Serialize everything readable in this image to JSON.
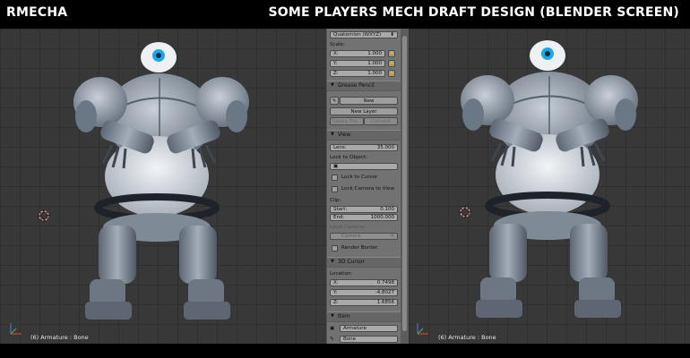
{
  "header": {
    "left_title": "RMECHA",
    "right_title": "SOME PLAYERS MECH DRAFT  DESIGN (BLENDER SCREEN)"
  },
  "viewport_left": {
    "status": "(6) Armature : Bone"
  },
  "viewport_right": {
    "status": "(6) Armature : Bone"
  },
  "panel": {
    "rotation_mode": "Quaternion (WXYZ)",
    "scale": {
      "label": "Scale:",
      "x_label": "X:",
      "x_value": "1.000",
      "y_label": "Y:",
      "y_value": "1.000",
      "z_label": "Z:",
      "z_value": "1.000"
    },
    "grease_pencil": {
      "header": "Grease Pencil",
      "new_button": "New",
      "new_layer_button": "New Layer",
      "delete_frame_button": "Delete Fra...",
      "convert_button": "Convert"
    },
    "view": {
      "header": "View",
      "lens_label": "Lens:",
      "lens_value": "35.000",
      "lock_to_object_label": "Lock to Object:",
      "lock_to_cursor_label": "Lock to Cursor",
      "lock_camera_label": "Lock Camera to View",
      "clip_label": "Clip:",
      "clip_start_label": "Start:",
      "clip_start_value": "0.100",
      "clip_end_label": "End:",
      "clip_end_value": "1000.000",
      "local_camera_label": "Local Camera:",
      "camera_value": "Camera",
      "render_border_label": "Render Border"
    },
    "cursor_3d": {
      "header": "3D Cursor",
      "location_label": "Location:",
      "x_label": "X:",
      "x_value": "0.7498",
      "y_label": "Y:",
      "y_value": "-4.8027",
      "z_label": "Z:",
      "z_value": "1.6856"
    },
    "item": {
      "header": "Item",
      "armature_value": "Armature",
      "bone_value": "Bone"
    }
  },
  "colors": {
    "viewport_bg": "#383838",
    "panel_bg": "#727272",
    "field_bg": "#a9a9a9",
    "title_text": "#ffffff",
    "mech_body": "#8a95a2",
    "mech_eye": "#1ea7e6"
  }
}
